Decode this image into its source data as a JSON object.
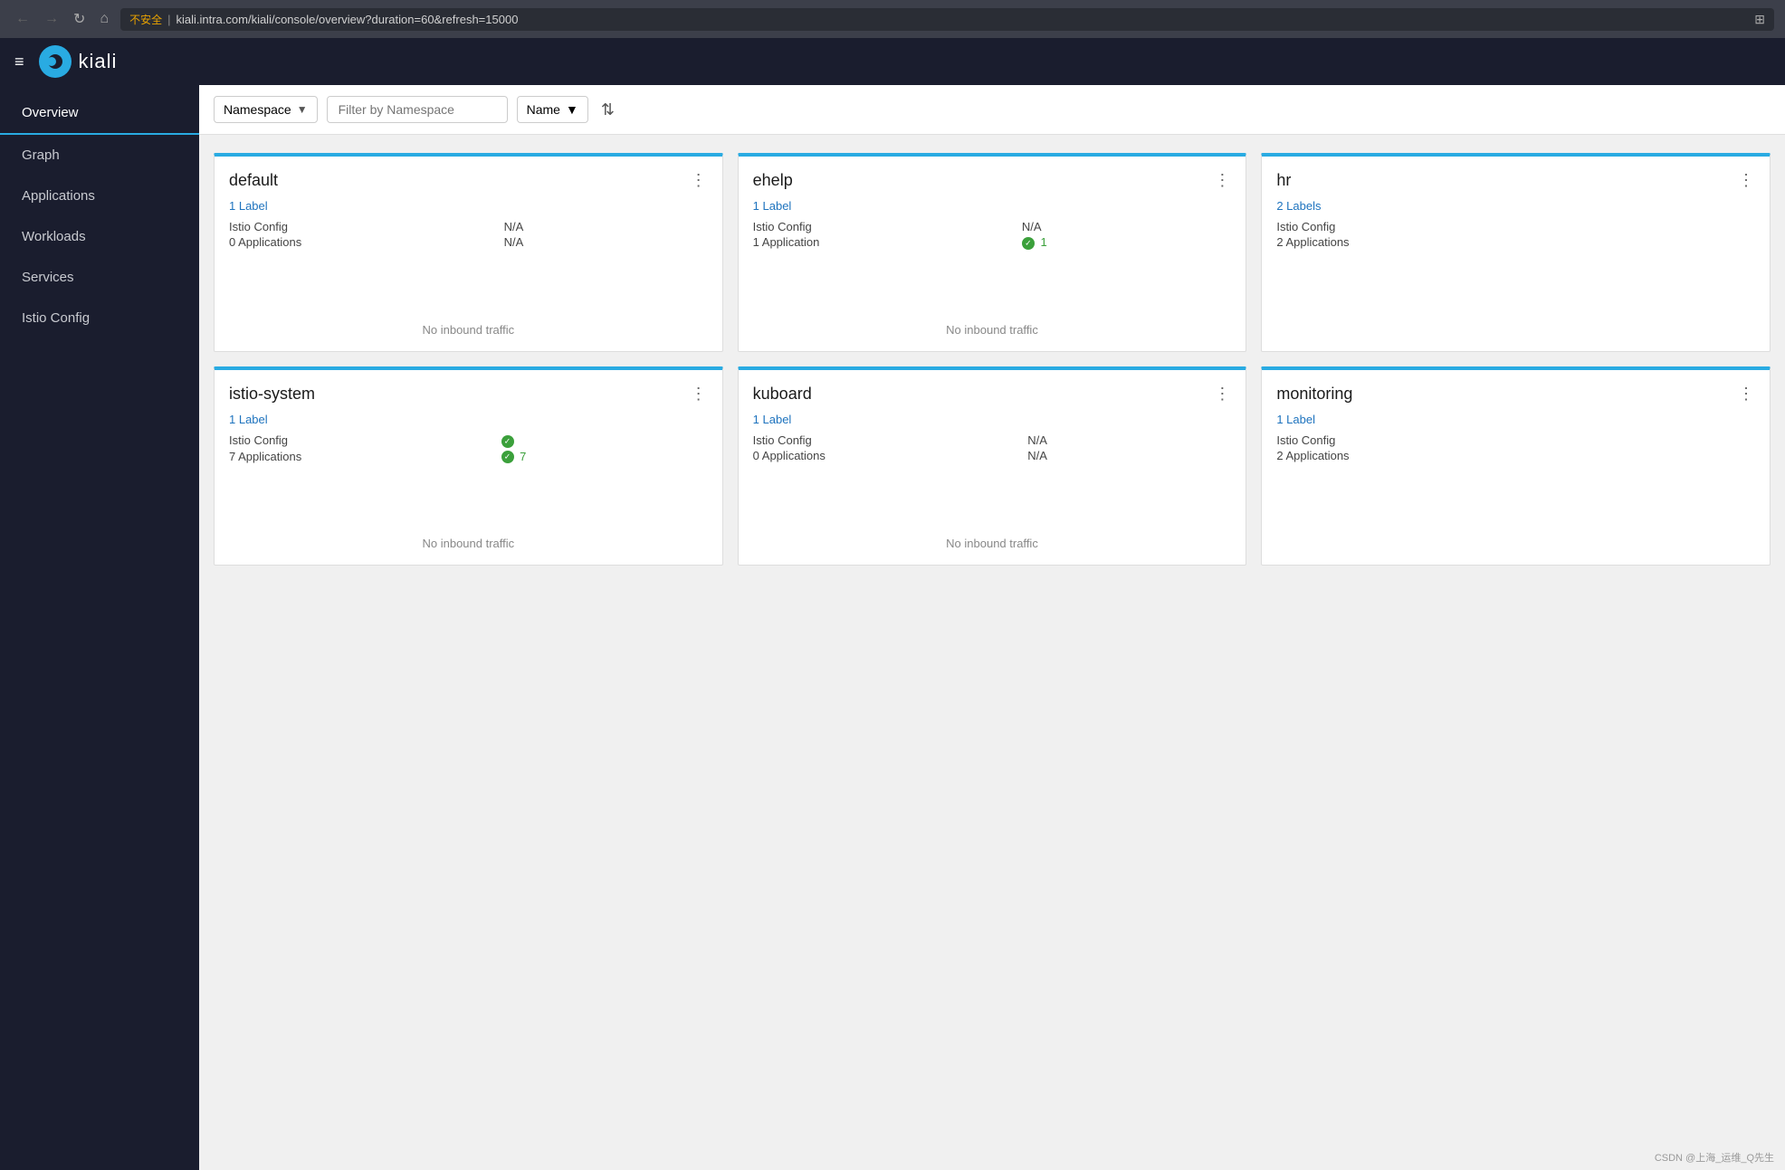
{
  "browser": {
    "back_btn": "←",
    "forward_btn": "→",
    "reload_btn": "↻",
    "home_btn": "⌂",
    "warning_label": "不安全",
    "url": "kiali.intra.com/kiali/console/overview?duration=60&refresh=15000",
    "translate_icon": "⊞"
  },
  "topbar": {
    "hamburger": "≡",
    "logo_text": "kiali"
  },
  "sidebar": {
    "items": [
      {
        "id": "overview",
        "label": "Overview",
        "active": true
      },
      {
        "id": "graph",
        "label": "Graph",
        "active": false
      },
      {
        "id": "applications",
        "label": "Applications",
        "active": false
      },
      {
        "id": "workloads",
        "label": "Workloads",
        "active": false
      },
      {
        "id": "services",
        "label": "Services",
        "active": false
      },
      {
        "id": "istio-config",
        "label": "Istio Config",
        "active": false
      }
    ]
  },
  "filterbar": {
    "namespace_label": "Namespace",
    "dropdown_arrow": "▼",
    "filter_placeholder": "Filter by Namespace",
    "name_label": "Name",
    "name_arrow": "▼",
    "sort_icon": "⇅"
  },
  "cards": [
    {
      "id": "default",
      "title": "default",
      "menu": "⋮",
      "label_text": "1 Label",
      "istio_config_label": "Istio Config",
      "istio_config_value": "N/A",
      "istio_config_type": "plain",
      "apps_label": "0 Applications",
      "apps_value": "N/A",
      "apps_type": "plain",
      "traffic_text": "No inbound traffic"
    },
    {
      "id": "ehelp",
      "title": "ehelp",
      "menu": "⋮",
      "label_text": "1 Label",
      "istio_config_label": "Istio Config",
      "istio_config_value": "N/A",
      "istio_config_type": "plain",
      "apps_label": "1 Application",
      "apps_value": "1",
      "apps_type": "green-check",
      "traffic_text": "No inbound traffic"
    },
    {
      "id": "hr",
      "title": "hr",
      "menu": "⋮",
      "label_text": "2 Labels",
      "istio_config_label": "Istio Config",
      "istio_config_value": "",
      "istio_config_type": "plain",
      "apps_label": "2 Applications",
      "apps_value": "",
      "apps_type": "plain",
      "traffic_text": ""
    },
    {
      "id": "istio-system",
      "title": "istio-system",
      "menu": "⋮",
      "label_text": "1 Label",
      "istio_config_label": "Istio Config",
      "istio_config_value": "",
      "istio_config_type": "check-only",
      "apps_label": "7 Applications",
      "apps_value": "7",
      "apps_type": "green-check",
      "traffic_text": "No inbound traffic"
    },
    {
      "id": "kuboard",
      "title": "kuboard",
      "menu": "⋮",
      "label_text": "1 Label",
      "istio_config_label": "Istio Config",
      "istio_config_value": "N/A",
      "istio_config_type": "plain",
      "apps_label": "0 Applications",
      "apps_value": "N/A",
      "apps_type": "plain",
      "traffic_text": "No inbound traffic"
    },
    {
      "id": "monitoring",
      "title": "monitoring",
      "menu": "⋮",
      "label_text": "1 Label",
      "istio_config_label": "Istio Config",
      "istio_config_value": "",
      "istio_config_type": "plain",
      "apps_label": "2 Applications",
      "apps_value": "",
      "apps_type": "plain",
      "traffic_text": ""
    }
  ],
  "footer": {
    "hint": "CSDN @上海_运维_Q先生"
  }
}
